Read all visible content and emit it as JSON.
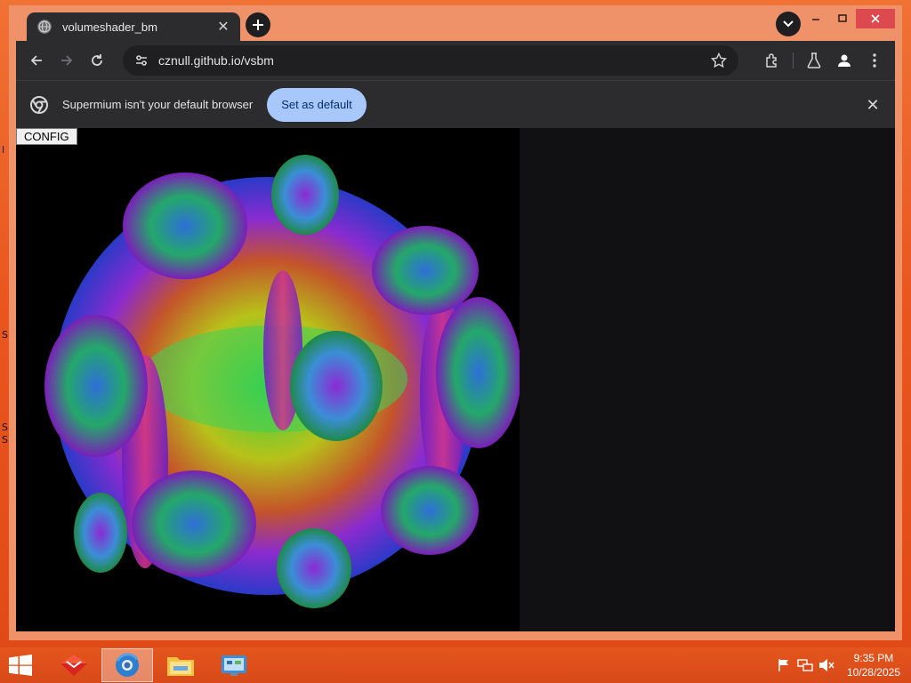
{
  "desktop": {
    "edge_text": [
      "l",
      "S",
      "S",
      "S"
    ]
  },
  "tab": {
    "title": "volumeshader_bm",
    "close_symbol": "✕"
  },
  "toolbar": {
    "url": "cznull.github.io/vsbm"
  },
  "infobar": {
    "message": "Supermium isn't your default browser",
    "button_label": "Set as default",
    "close_symbol": "✕"
  },
  "page": {
    "config_label": "CONFIG"
  },
  "taskbar": {
    "time": "9:35 PM",
    "date": "10/28/2025"
  },
  "icons": [
    "globe-icon",
    "close-icon",
    "plus-icon",
    "chevron-down-icon",
    "minimize-icon",
    "maximize-icon",
    "back-arrow-icon",
    "forward-arrow-icon",
    "reload-icon",
    "site-settings-icon",
    "star-icon",
    "extensions-icon",
    "labs-flask-icon",
    "profile-icon",
    "more-vert-icon",
    "chrome-logo-icon",
    "windows-logo-icon",
    "app-icon",
    "browser-icon",
    "folder-icon",
    "control-panel-icon",
    "flag-icon",
    "network-icon",
    "speaker-muted-icon"
  ],
  "colors": {
    "wallpaper": "#e9571f",
    "titlebar": "#ef926a",
    "chrome_dark": "#2c2c2f",
    "set_default_button": "#a8c7fa",
    "close_button": "#dc4a4f"
  }
}
